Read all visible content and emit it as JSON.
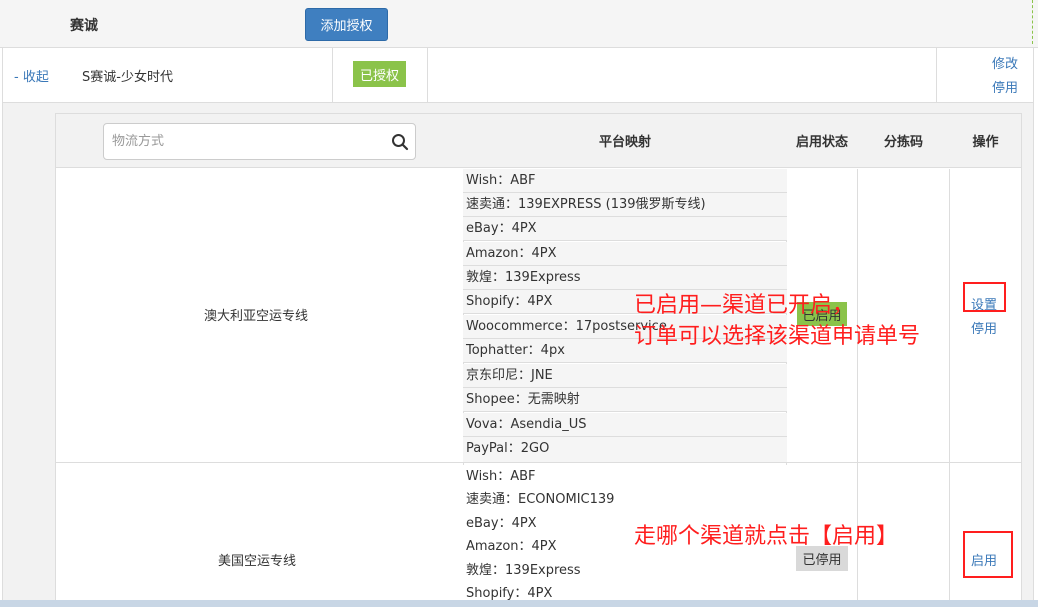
{
  "header": {
    "title": "赛诚",
    "add_button": "添加授权"
  },
  "shop": {
    "collapse": "- 收起",
    "name": "S赛诚-少女时代",
    "auth_status": "已授权",
    "edit": "修改",
    "disable": "停用"
  },
  "table": {
    "search_placeholder": "物流方式",
    "columns": {
      "mapping": "平台映射",
      "status": "启用状态",
      "sort_code": "分拣码",
      "action": "操作"
    },
    "rows": [
      {
        "name": "澳大利亚空运专线",
        "mappings": [
          "Wish：ABF",
          "速卖通：139EXPRESS (139俄罗斯专线)",
          "eBay：4PX",
          "Amazon：4PX",
          "敦煌：139Express",
          "Shopify：4PX",
          "Woocommerce：17postservice",
          "Tophatter：4px",
          "京东印尼：JNE",
          "Shopee：无需映射",
          "Vova：Asendia_US",
          "PayPal：2GO"
        ],
        "status": "已启用",
        "actions": [
          "设置",
          "停用"
        ]
      },
      {
        "name": "美国空运专线",
        "mappings": [
          "Wish：ABF",
          "速卖通：ECONOMIC139",
          "eBay：4PX",
          "Amazon：4PX",
          "敦煌：139Express",
          "Shopify：4PX"
        ],
        "status": "已停用",
        "actions": [
          "启用"
        ]
      }
    ]
  },
  "annotations": {
    "note1_line1": "已启用—渠道已开启，",
    "note1_line2": "订单可以选择该渠道申请单号",
    "note2": "走哪个渠道就点击【启用】"
  },
  "colors": {
    "primary": "#3f7fc0",
    "link": "#3a78b8",
    "enabled": "#8bc34a",
    "disabled": "#d9d9d9",
    "annotation": "#ff1e1e"
  }
}
